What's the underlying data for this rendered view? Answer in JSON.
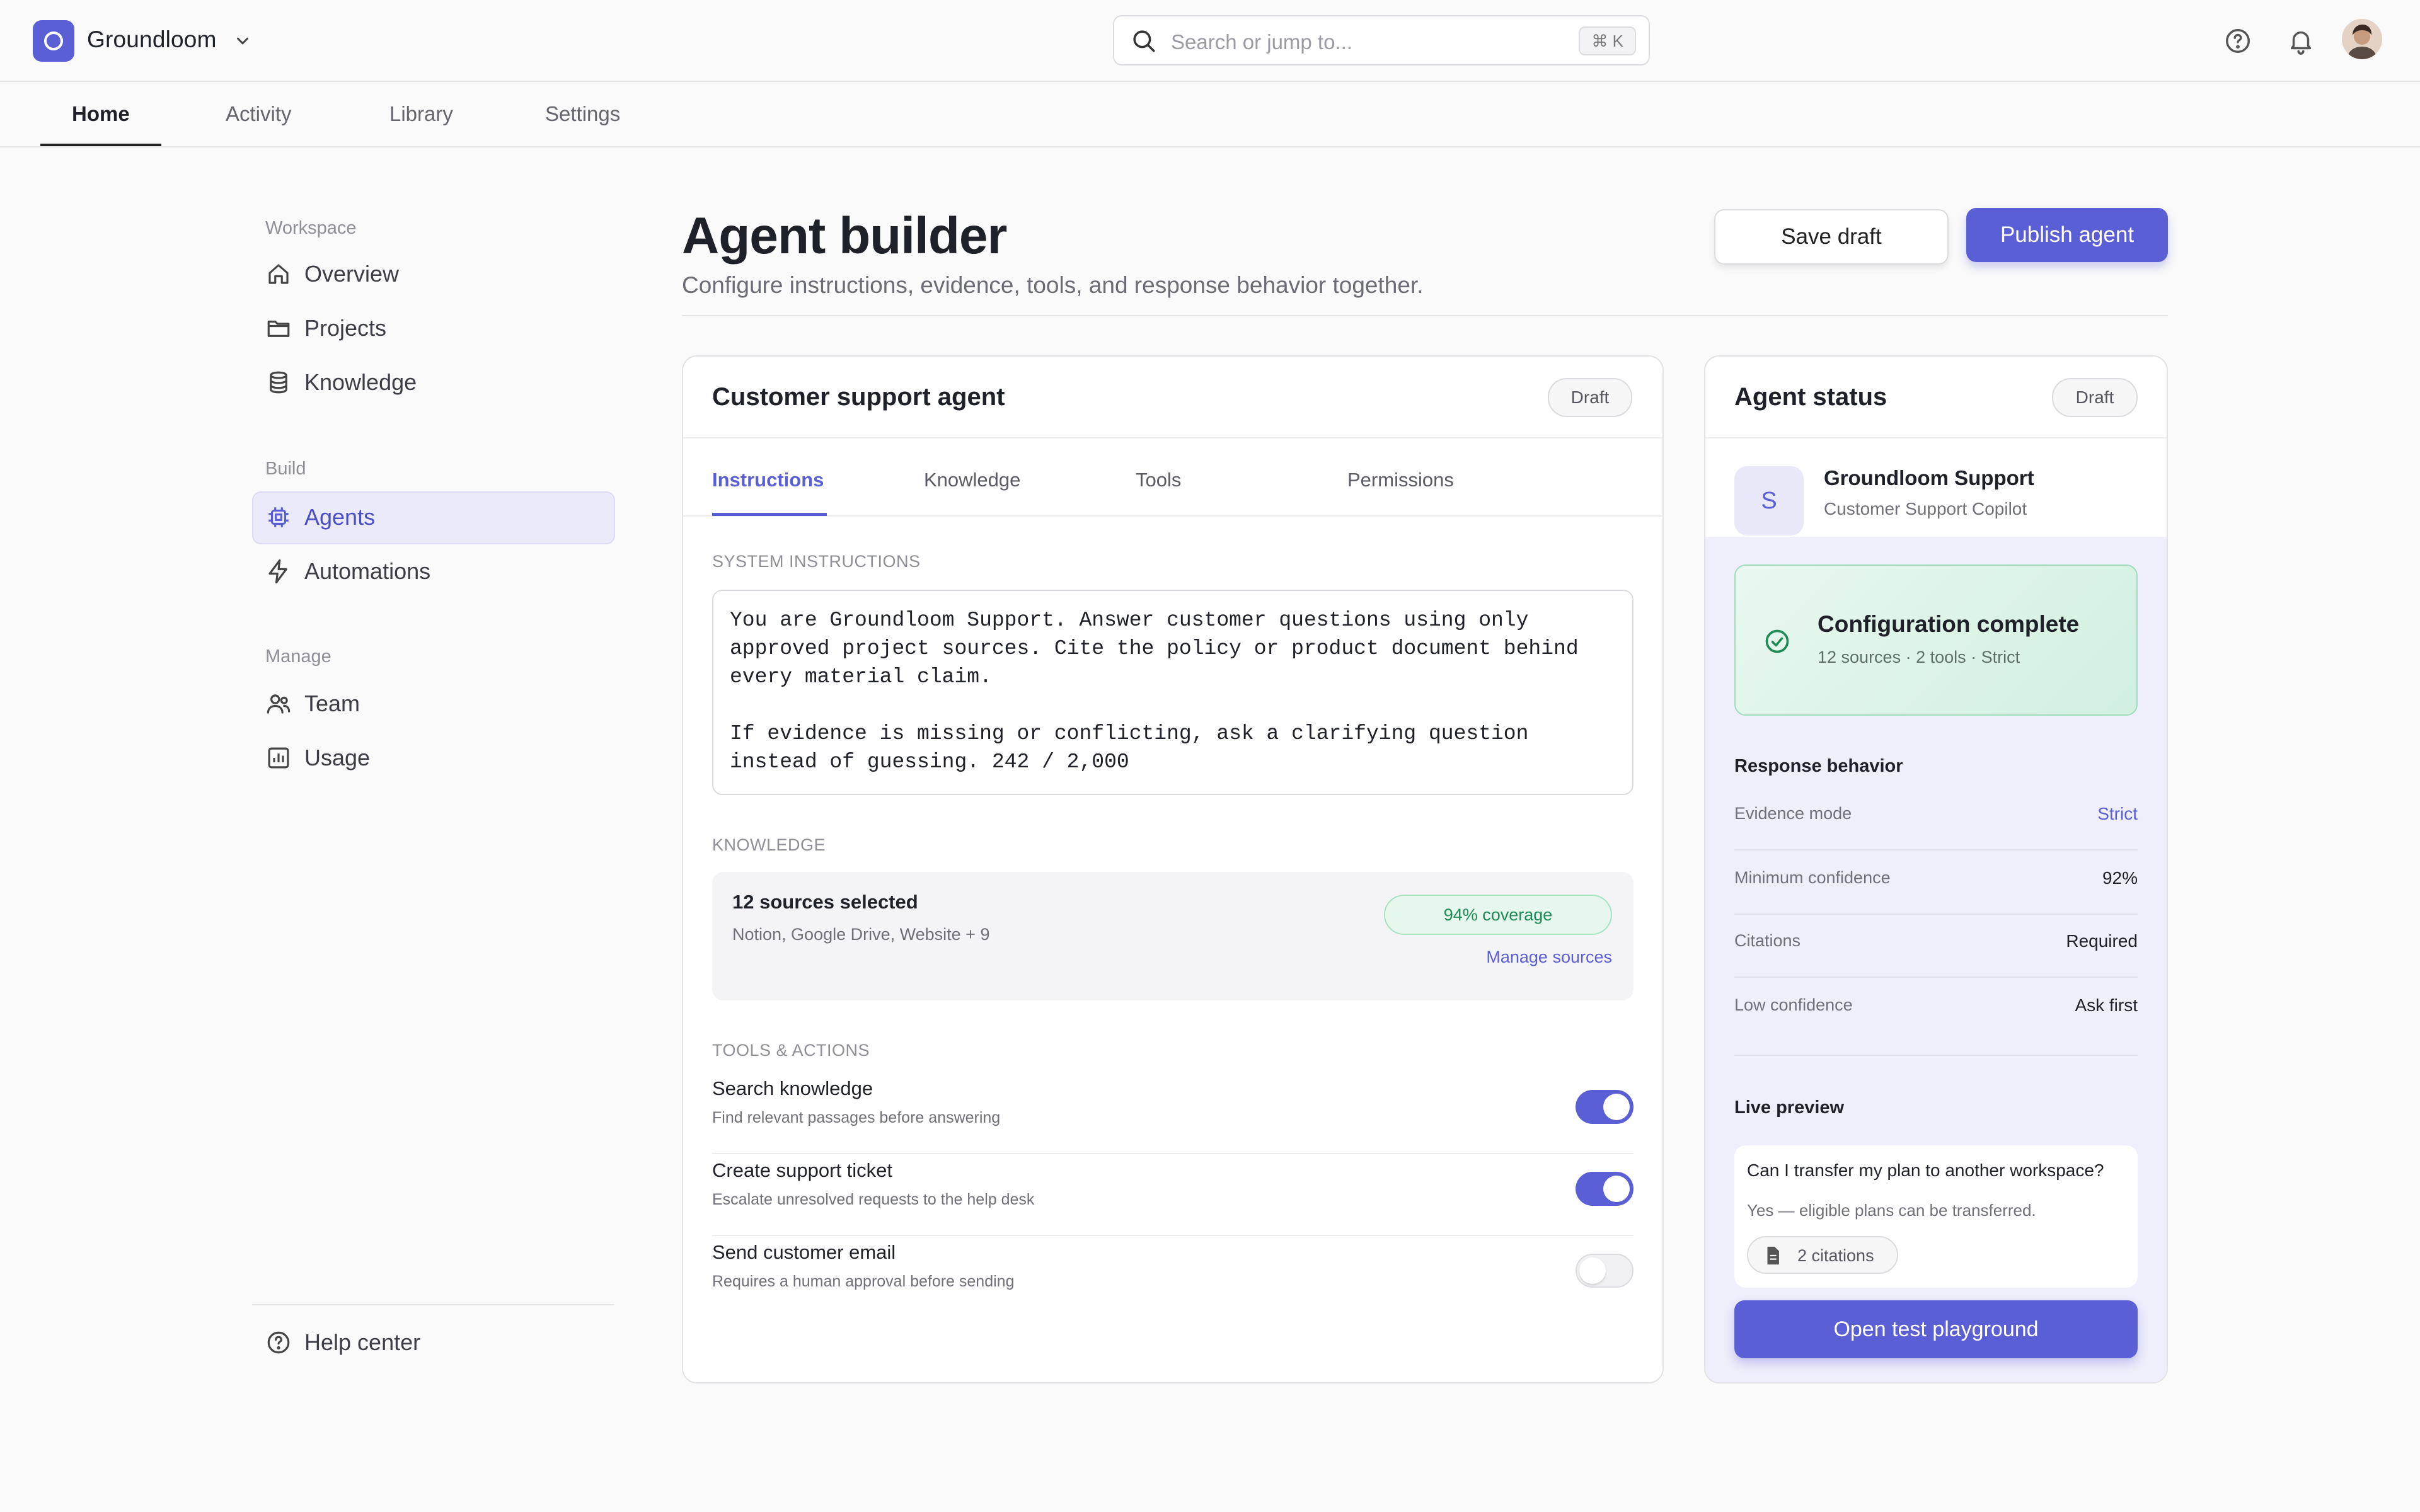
{
  "app": {
    "name": "Groundloom"
  },
  "search": {
    "placeholder": "Search or jump to...",
    "shortcut": "⌘ K"
  },
  "nav": {
    "tabs": [
      "Home",
      "Activity",
      "Library",
      "Settings"
    ],
    "active": "Home"
  },
  "sidebar": {
    "sections": [
      {
        "title": "Workspace",
        "items": [
          {
            "label": "Overview",
            "icon": "home-icon"
          },
          {
            "label": "Projects",
            "icon": "folder-icon"
          },
          {
            "label": "Knowledge",
            "icon": "database-icon"
          }
        ]
      },
      {
        "title": "Build",
        "items": [
          {
            "label": "Agents",
            "icon": "chip-icon",
            "active": true
          },
          {
            "label": "Automations",
            "icon": "bolt-icon"
          }
        ]
      },
      {
        "title": "Manage",
        "items": [
          {
            "label": "Team",
            "icon": "users-icon"
          },
          {
            "label": "Usage",
            "icon": "chart-icon"
          }
        ]
      }
    ],
    "footer": {
      "label": "Help center",
      "icon": "help-icon"
    }
  },
  "page": {
    "title": "Agent builder",
    "subtitle": "Configure instructions, evidence, tools, and response behavior together.",
    "save_label": "Save draft",
    "publish_label": "Publish agent"
  },
  "agent_card": {
    "title": "Customer support agent",
    "badge": "Draft",
    "tabs": [
      "Instructions",
      "Knowledge",
      "Tools",
      "Permissions"
    ],
    "active_tab": "Instructions",
    "instructions_label": "SYSTEM INSTRUCTIONS",
    "instructions_text": "You are Groundloom Support. Answer customer questions using only approved project sources. Cite the policy or product document behind every material claim.\n\nIf evidence is missing or conflicting, ask a clarifying question instead of guessing. 242 / 2,000",
    "knowledge_label": "KNOWLEDGE",
    "knowledge": {
      "title": "12 sources selected",
      "sources": "Notion, Google Drive, Website + 9",
      "coverage": "94% coverage",
      "manage": "Manage sources"
    },
    "tools_label": "TOOLS & ACTIONS",
    "tools": [
      {
        "title": "Search knowledge",
        "desc": "Find relevant passages before answering",
        "enabled": true
      },
      {
        "title": "Create support ticket",
        "desc": "Escalate unresolved requests to the help desk",
        "enabled": true
      },
      {
        "title": "Send customer email",
        "desc": "Requires a human approval before sending",
        "enabled": false
      }
    ]
  },
  "status_card": {
    "title": "Agent status",
    "badge": "Draft",
    "agent_initial": "S",
    "agent_name": "Groundloom Support",
    "agent_role": "Customer Support Copilot",
    "config_title": "Configuration complete",
    "config_meta": "12 sources · 2 tools · Strict",
    "behavior_title": "Response behavior",
    "behavior": [
      {
        "label": "Evidence mode",
        "value": "Strict",
        "accent": true
      },
      {
        "label": "Minimum confidence",
        "value": "92%"
      },
      {
        "label": "Citations",
        "value": "Required"
      },
      {
        "label": "Low confidence",
        "value": "Ask first"
      }
    ],
    "preview_title": "Live preview",
    "preview_question": "Can I transfer my plan to another workspace?",
    "preview_answer": "Yes — eligible plans can be transferred.",
    "citations": "2 citations",
    "playground_label": "Open test playground"
  },
  "colors": {
    "accent": "#5b5fd6",
    "success": "#1f8a55"
  }
}
